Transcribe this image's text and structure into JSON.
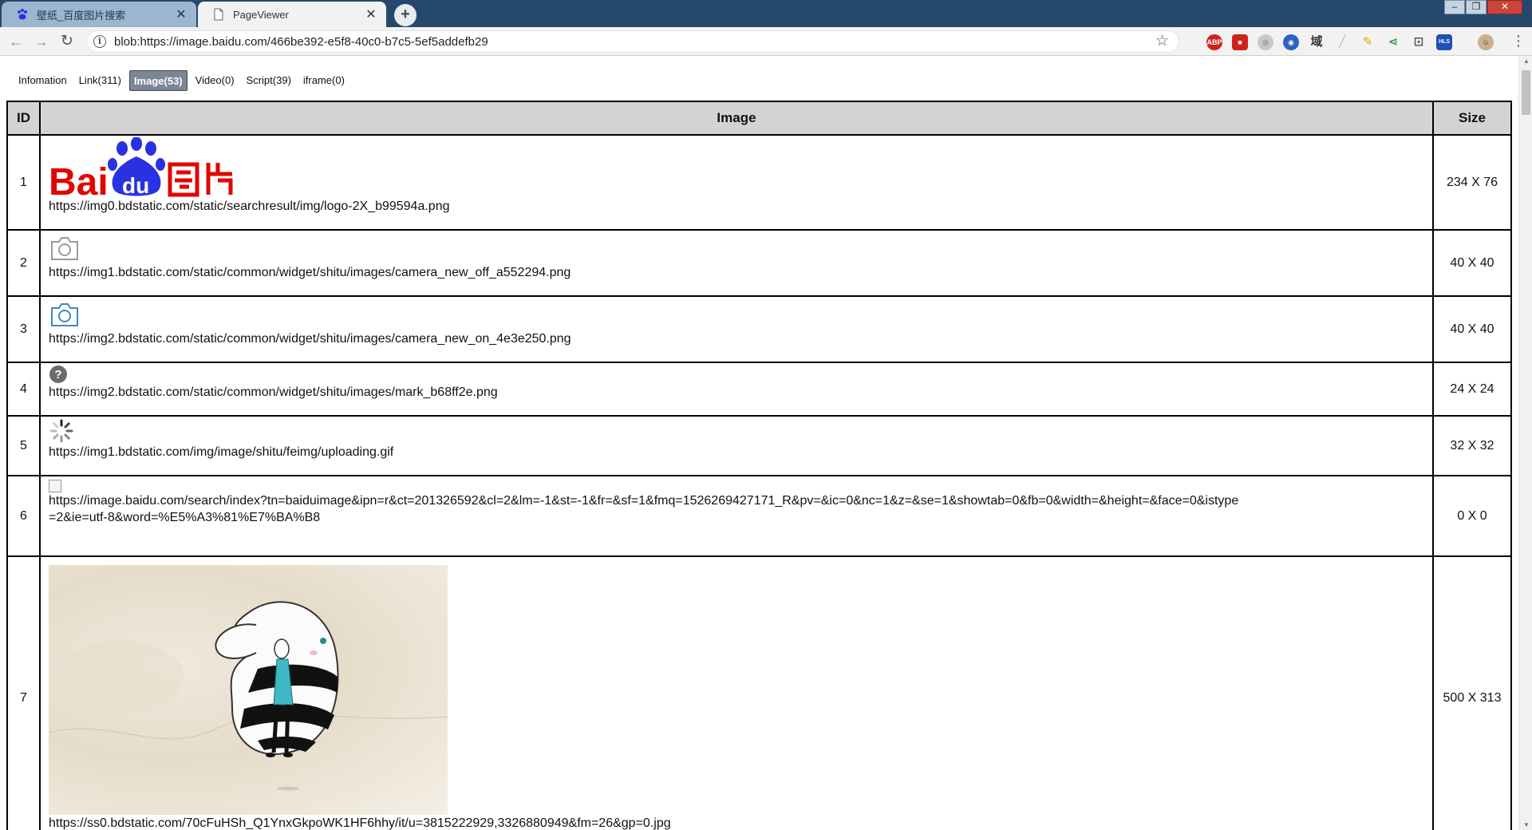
{
  "browser": {
    "tabs": [
      {
        "title": "壁纸_百度图片搜索",
        "favicon": "baidu-paw-icon",
        "active": false
      },
      {
        "title": "PageViewer",
        "favicon": "page-icon",
        "active": true
      }
    ],
    "new_tab_label": "+",
    "address": "blob:https://image.baidu.com/466be392-e5f8-40c0-b7c5-5ef5addefb29",
    "extension_labels": {
      "abp": "ABP",
      "hls": "HLS",
      "domain": "域"
    }
  },
  "viewer": {
    "tabs": [
      {
        "label": "Infomation",
        "active": false
      },
      {
        "label": "Link(311)",
        "active": false
      },
      {
        "label": "Image(53)",
        "active": true
      },
      {
        "label": "Video(0)",
        "active": false
      },
      {
        "label": "Script(39)",
        "active": false
      },
      {
        "label": "iframe(0)",
        "active": false
      }
    ],
    "table": {
      "headers": {
        "id": "ID",
        "image": "Image",
        "size": "Size"
      },
      "rows": [
        {
          "id": "1",
          "url": "https://img0.bdstatic.com/static/searchresult/img/logo-2X_b99594a.png",
          "size": "234 X 76",
          "thumb": "baidu-image-logo"
        },
        {
          "id": "2",
          "url": "https://img1.bdstatic.com/static/common/widget/shitu/images/camera_new_off_a552294.png",
          "size": "40 X 40",
          "thumb": "camera-off-icon"
        },
        {
          "id": "3",
          "url": "https://img2.bdstatic.com/static/common/widget/shitu/images/camera_new_on_4e3e250.png",
          "size": "40 X 40",
          "thumb": "camera-on-icon"
        },
        {
          "id": "4",
          "url": "https://img2.bdstatic.com/static/common/widget/shitu/images/mark_b68ff2e.png",
          "size": "24 X 24",
          "thumb": "question-mark-icon"
        },
        {
          "id": "5",
          "url": "https://img1.bdstatic.com/img/image/shitu/feimg/uploading.gif",
          "size": "32 X 32",
          "thumb": "loading-spinner-icon"
        },
        {
          "id": "6",
          "url": "https://image.baidu.com/search/index?tn=baiduimage&ipn=r&ct=201326592&cl=2&lm=-1&st=-1&fr=&sf=1&fmq=1526269427171_R&pv=&ic=0&nc=1&z=&se=1&showtab=0&fb=0&width=&height=&face=0&istype=2&ie=utf-8&word=%E5%A3%81%E7%BA%B8",
          "size": "0 X 0",
          "thumb": "broken-image-icon"
        },
        {
          "id": "7",
          "url": "https://ss0.bdstatic.com/70cFuHSh_Q1YnxGkpoWK1HF6hhy/it/u=3815222929,3326880949&fm=26&gp=0.jpg",
          "size": "500 X 313",
          "thumb": "wallpaper-illustration"
        }
      ]
    }
  },
  "colors": {
    "tabstrip": "#27486d",
    "active_viewer_tab": "#7c8796",
    "table_header": "#d3d3d3",
    "baidu_red": "#e10602",
    "baidu_blue": "#2932e1",
    "camera_on_blue": "#3f88c5"
  }
}
